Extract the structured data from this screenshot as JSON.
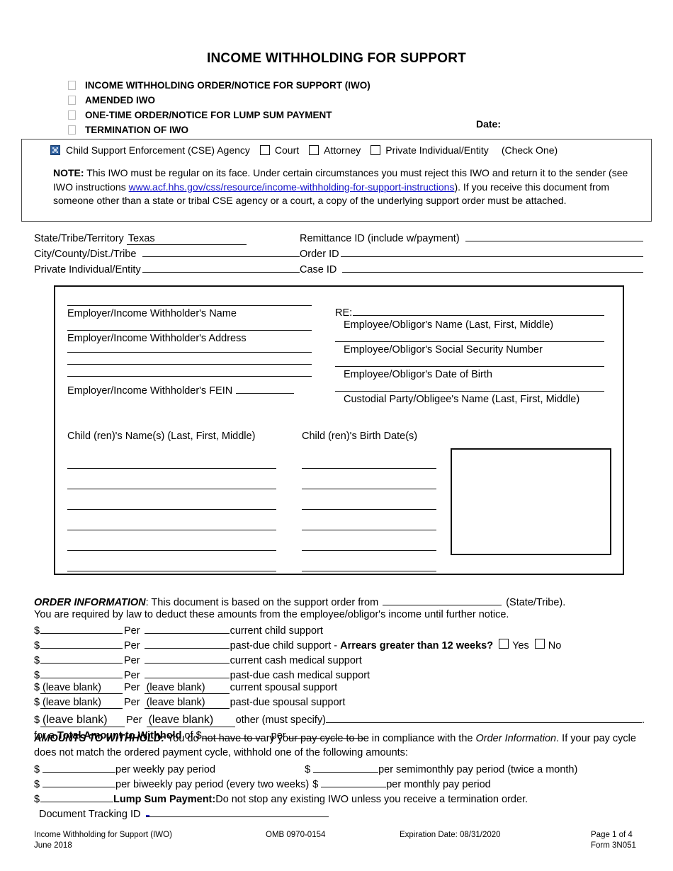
{
  "document": {
    "title": "INCOME WITHHOLDING FOR SUPPORT"
  },
  "form_types": {
    "items": [
      {
        "label": "INCOME WITHHOLDING ORDER/NOTICE FOR SUPPORT (IWO)",
        "checked": false
      },
      {
        "label": "AMENDED IWO",
        "checked": false
      },
      {
        "label": "ONE-TIME ORDER/NOTICE FOR LUMP SUM PAYMENT",
        "checked": false
      },
      {
        "label": "TERMINATION OF IWO",
        "checked": false
      }
    ],
    "date_label": "Date:",
    "date_value": ""
  },
  "sender": {
    "cse_label": "Child Support Enforcement (CSE) Agency",
    "court_label": "Court",
    "attorney_label": "Attorney",
    "private_label": "Private Individual/Entity",
    "check_one": "(Check One)",
    "checked": "cse-agency"
  },
  "note": {
    "bold_prefix": "NOTE:",
    "part1": " This IWO must be regular on its face. Under certain circumstances you must reject this IWO and return it to the sender (see IWO instructions ",
    "link": "www.acf.hhs.gov/css/resource/income-withholding-for-support-instructions",
    "part2": "). If you receive this document from someone other than a state or tribal CSE agency or a court, a copy of the underlying support order must be attached."
  },
  "ids": {
    "state_tribe_label": "State/Tribe/Territory",
    "state_tribe_value": "Texas",
    "city_county_label": "City/County/Dist./Tribe",
    "city_county_value": "",
    "private_entity_label": "Private Individual/Entity",
    "private_entity_value": "",
    "remittance_label": "Remittance ID (include w/payment)",
    "remittance_value": "",
    "order_id_label": "Order ID",
    "order_id_value": "",
    "case_id_label": "Case ID",
    "case_id_value": ""
  },
  "party_box": {
    "employer_name_caption": "Employer/Income Withholder's Name",
    "employer_address_caption": "Employer/Income Withholder's Address",
    "employer_fein_caption": "Employer/Income Withholder's FEIN",
    "re_label": "RE:",
    "employee_name_caption": "Employee/Obligor's Name (Last, First, Middle)",
    "employee_ssn_caption": "Employee/Obligor's Social Security Number",
    "employee_dob_caption": "Employee/Obligor's Date of Birth",
    "custodial_caption": "Custodial Party/Obligee's Name (Last, First, Middle)",
    "children_names_header": "Child (ren)'s Name(s) (Last, First, Middle)",
    "children_dates_header": "Child (ren)'s Birth Date(s)",
    "children_rows": 6,
    "children_names": [
      "",
      "",
      "",
      "",
      "",
      ""
    ],
    "children_birth_dates": [
      "",
      "",
      "",
      "",
      "",
      ""
    ]
  },
  "order_information": {
    "heading": "ORDER INFORMATION",
    "lead_1": ": This document is based on the support order from",
    "lead_state_value": "",
    "lead_2": "(State/Tribe).",
    "subtext": "You are required by law to deduct these amounts from the employee/obligor's income until further notice.",
    "rows": [
      {
        "amount": "",
        "per": "",
        "description": "current child support"
      },
      {
        "amount": "",
        "per": "",
        "description": "past-due child support -",
        "arrears_question": "Arrears greater than 12 weeks?",
        "yes_label": "Yes",
        "no_label": "No",
        "yes_checked": false,
        "no_checked": false
      },
      {
        "amount": "",
        "per": "",
        "description": "current cash medical support"
      },
      {
        "amount": "",
        "per": "",
        "description": "past-due cash medical support"
      },
      {
        "amount": "(leave blank)",
        "per": "(leave blank)",
        "description": "current spousal support"
      },
      {
        "amount": "(leave blank)",
        "per": "(leave blank)",
        "description": "past-due spousal support"
      },
      {
        "amount": "(leave blank)",
        "per": "(leave blank)",
        "description": "other (must specify)",
        "specify_value": ""
      }
    ],
    "total_prefix": "for a",
    "total_bold": "Total Amount to Withhold",
    "total_mid": "of $",
    "total_amount": "",
    "total_per_label": "per",
    "total_per_value": ""
  },
  "amounts_to_withhold": {
    "heading": "AMOUNTS TO WITHHOLD:",
    "para_1": " You do not have to vary your pay cycle to be in compliance with the ",
    "para_italic": "Order Information",
    "para_2": ". If your pay cycle does not match the ordered payment cycle, withhold one of the following amounts:",
    "weekly": {
      "amount": "",
      "label": "per weekly pay period"
    },
    "semimonthly": {
      "amount": "",
      "label": "per semimonthly pay period (twice a month)"
    },
    "biweekly": {
      "amount": "",
      "label": "per biweekly pay period (every two weeks)"
    },
    "monthly": {
      "amount": "",
      "label": "per monthly pay period"
    },
    "lump_sum": {
      "amount": "",
      "bold_label": "Lump Sum Payment:",
      "text": " Do not stop any existing IWO unless you receive a termination order."
    },
    "document_tracking_label": "Document Tracking ID",
    "document_tracking_value": ""
  },
  "footer": {
    "form_name": "Income Withholding for Support (IWO)",
    "form_date": "June 2018",
    "omb": "OMB 0970-0154",
    "expiration": "Expiration Date: 08/31/2020",
    "page": "Page 1 of 4",
    "form_number": "Form 3N051"
  },
  "colors": {
    "link": "#1414c8",
    "checked_box": "#2e5f9e",
    "text": "#000000"
  }
}
